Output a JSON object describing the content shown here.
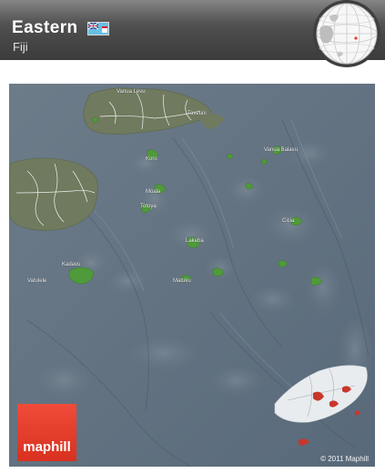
{
  "header": {
    "title": "Eastern",
    "subtitle": "Fiji",
    "flag_icon": "fiji-flag-icon",
    "globe_icon": "globe-locator-icon"
  },
  "map": {
    "style": "satellite-3d",
    "region": "Eastern",
    "country": "Fiji",
    "places": [
      {
        "name": "Vanua Levu"
      },
      {
        "name": "Koro"
      },
      {
        "name": "Lakeba"
      },
      {
        "name": "Kadavu"
      },
      {
        "name": "Moala"
      },
      {
        "name": "Matuku"
      },
      {
        "name": "Totoya"
      },
      {
        "name": "Vanua Balavu"
      },
      {
        "name": "Cicia"
      },
      {
        "name": "Taveuni"
      },
      {
        "name": "Vatulele"
      }
    ],
    "colors": {
      "ocean": "#61717f",
      "highlight_region": "#4f9a3a",
      "land": "#6f7a5e",
      "boundary": "#ffffff"
    }
  },
  "branding": {
    "logo_text": "maphill",
    "copyright": "© 2011 Maphill",
    "logo_color": "#e53e2c"
  }
}
